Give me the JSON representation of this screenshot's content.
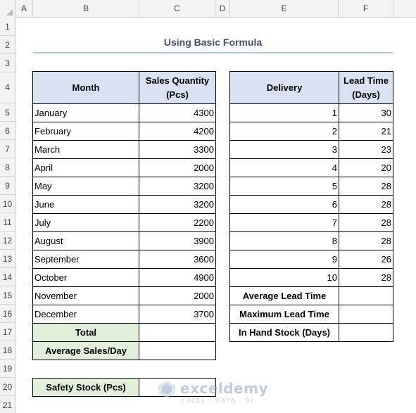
{
  "columns": [
    "A",
    "B",
    "C",
    "D",
    "E",
    "F"
  ],
  "rows": [
    "1",
    "2",
    "3",
    "4",
    "5",
    "6",
    "7",
    "8",
    "9",
    "10",
    "11",
    "12",
    "13",
    "14",
    "15",
    "16",
    "17",
    "18",
    "19",
    "20",
    "21"
  ],
  "title": "Using Basic Formula",
  "sales_table": {
    "header_month": "Month",
    "header_qty": "Sales Quantity (Pcs)",
    "rows": [
      {
        "month": "January",
        "qty": "4300"
      },
      {
        "month": "February",
        "qty": "4200"
      },
      {
        "month": "March",
        "qty": "3300"
      },
      {
        "month": "April",
        "qty": "2000"
      },
      {
        "month": "May",
        "qty": "3200"
      },
      {
        "month": "June",
        "qty": "3200"
      },
      {
        "month": "July",
        "qty": "2200"
      },
      {
        "month": "August",
        "qty": "3900"
      },
      {
        "month": "September",
        "qty": "3600"
      },
      {
        "month": "October",
        "qty": "4900"
      },
      {
        "month": "November",
        "qty": "2000"
      },
      {
        "month": "December",
        "qty": "3700"
      }
    ],
    "total_label": "Total",
    "avg_label": "Average Sales/Day",
    "total_value": "",
    "avg_value": ""
  },
  "lead_table": {
    "header_delivery": "Delivery",
    "header_lead": "Lead Time (Days)",
    "rows": [
      {
        "delivery": "1",
        "lead": "30"
      },
      {
        "delivery": "2",
        "lead": "21"
      },
      {
        "delivery": "3",
        "lead": "23"
      },
      {
        "delivery": "4",
        "lead": "20"
      },
      {
        "delivery": "5",
        "lead": "28"
      },
      {
        "delivery": "6",
        "lead": "28"
      },
      {
        "delivery": "7",
        "lead": "28"
      },
      {
        "delivery": "8",
        "lead": "28"
      },
      {
        "delivery": "9",
        "lead": "26"
      },
      {
        "delivery": "10",
        "lead": "28"
      }
    ],
    "avg_lead_label": "Average Lead Time",
    "max_lead_label": "Maximum Lead Time",
    "in_hand_label": "In Hand Stock (Days)",
    "avg_lead_value": "",
    "max_lead_value": "",
    "in_hand_value": ""
  },
  "safety": {
    "label": "Safety Stock (Pcs)",
    "value": ""
  },
  "watermark": {
    "name": "exceldemy",
    "tagline": "EXCEL · DATA · BI"
  },
  "colors": {
    "header_fill": "#d9e1f2",
    "label_fill": "#e2efda",
    "title_color": "#44546a",
    "title_underline": "#b4c6e7"
  }
}
